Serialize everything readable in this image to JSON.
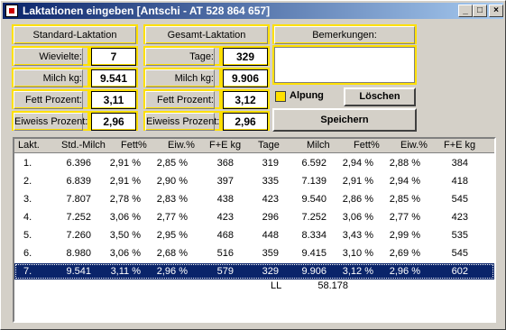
{
  "window": {
    "title": "Laktationen eingeben [Antschi - AT 528 864 657]",
    "min": "_",
    "max": "□",
    "close": "×"
  },
  "standard": {
    "header": "Standard-Laktation",
    "wievielte_label": "Wievielte:",
    "wievielte": "7",
    "milch_label": "Milch kg:",
    "milch": "9.541",
    "fett_label": "Fett Prozent:",
    "fett": "3,11",
    "eiweiss_label": "Eiweiss Prozent:",
    "eiweiss": "2,96"
  },
  "gesamt": {
    "header": "Gesamt-Laktation",
    "tage_label": "Tage:",
    "tage": "329",
    "milch_label": "Milch kg:",
    "milch": "9.906",
    "fett_label": "Fett Prozent:",
    "fett": "3,12",
    "eiweiss_label": "Eiweiss Prozent:",
    "eiweiss": "2,96"
  },
  "notes": {
    "header": "Bemerkungen:",
    "value": ""
  },
  "alpung_label": "Alpung",
  "loeschen_label": "Löschen",
  "speichern_label": "Speichern",
  "columns": [
    "Lakt.",
    "Std.-Milch",
    "Fett%",
    "Eiw.%",
    "F+E kg",
    "Tage",
    "Milch",
    "Fett%",
    "Eiw.%",
    "F+E kg"
  ],
  "rows": [
    [
      "1.",
      "6.396",
      "2,91 %",
      "2,85 %",
      "368",
      "319",
      "6.592",
      "2,94 %",
      "2,88 %",
      "384"
    ],
    [
      "2.",
      "6.839",
      "2,91 %",
      "2,90 %",
      "397",
      "335",
      "7.139",
      "2,91 %",
      "2,94 %",
      "418"
    ],
    [
      "3.",
      "7.807",
      "2,78 %",
      "2,83 %",
      "438",
      "423",
      "9.540",
      "2,86 %",
      "2,85 %",
      "545"
    ],
    [
      "4.",
      "7.252",
      "3,06 %",
      "2,77 %",
      "423",
      "296",
      "7.252",
      "3,06 %",
      "2,77 %",
      "423"
    ],
    [
      "5.",
      "7.260",
      "3,50 %",
      "2,95 %",
      "468",
      "448",
      "8.334",
      "3,43 %",
      "2,99 %",
      "535"
    ],
    [
      "6.",
      "8.980",
      "3,06 %",
      "2,68 %",
      "516",
      "359",
      "9.415",
      "3,10 %",
      "2,69 %",
      "545"
    ],
    [
      "7.",
      "9.541",
      "3,11 %",
      "2,96 %",
      "579",
      "329",
      "9.906",
      "3,12 %",
      "2,96 %",
      "602"
    ]
  ],
  "selected_row_index": 6,
  "summary": {
    "label": "LL",
    "value": "58.178"
  },
  "colors": {
    "highlight": "#ffe000",
    "selection": "#0a246a",
    "titlebar": "#0a246a"
  }
}
